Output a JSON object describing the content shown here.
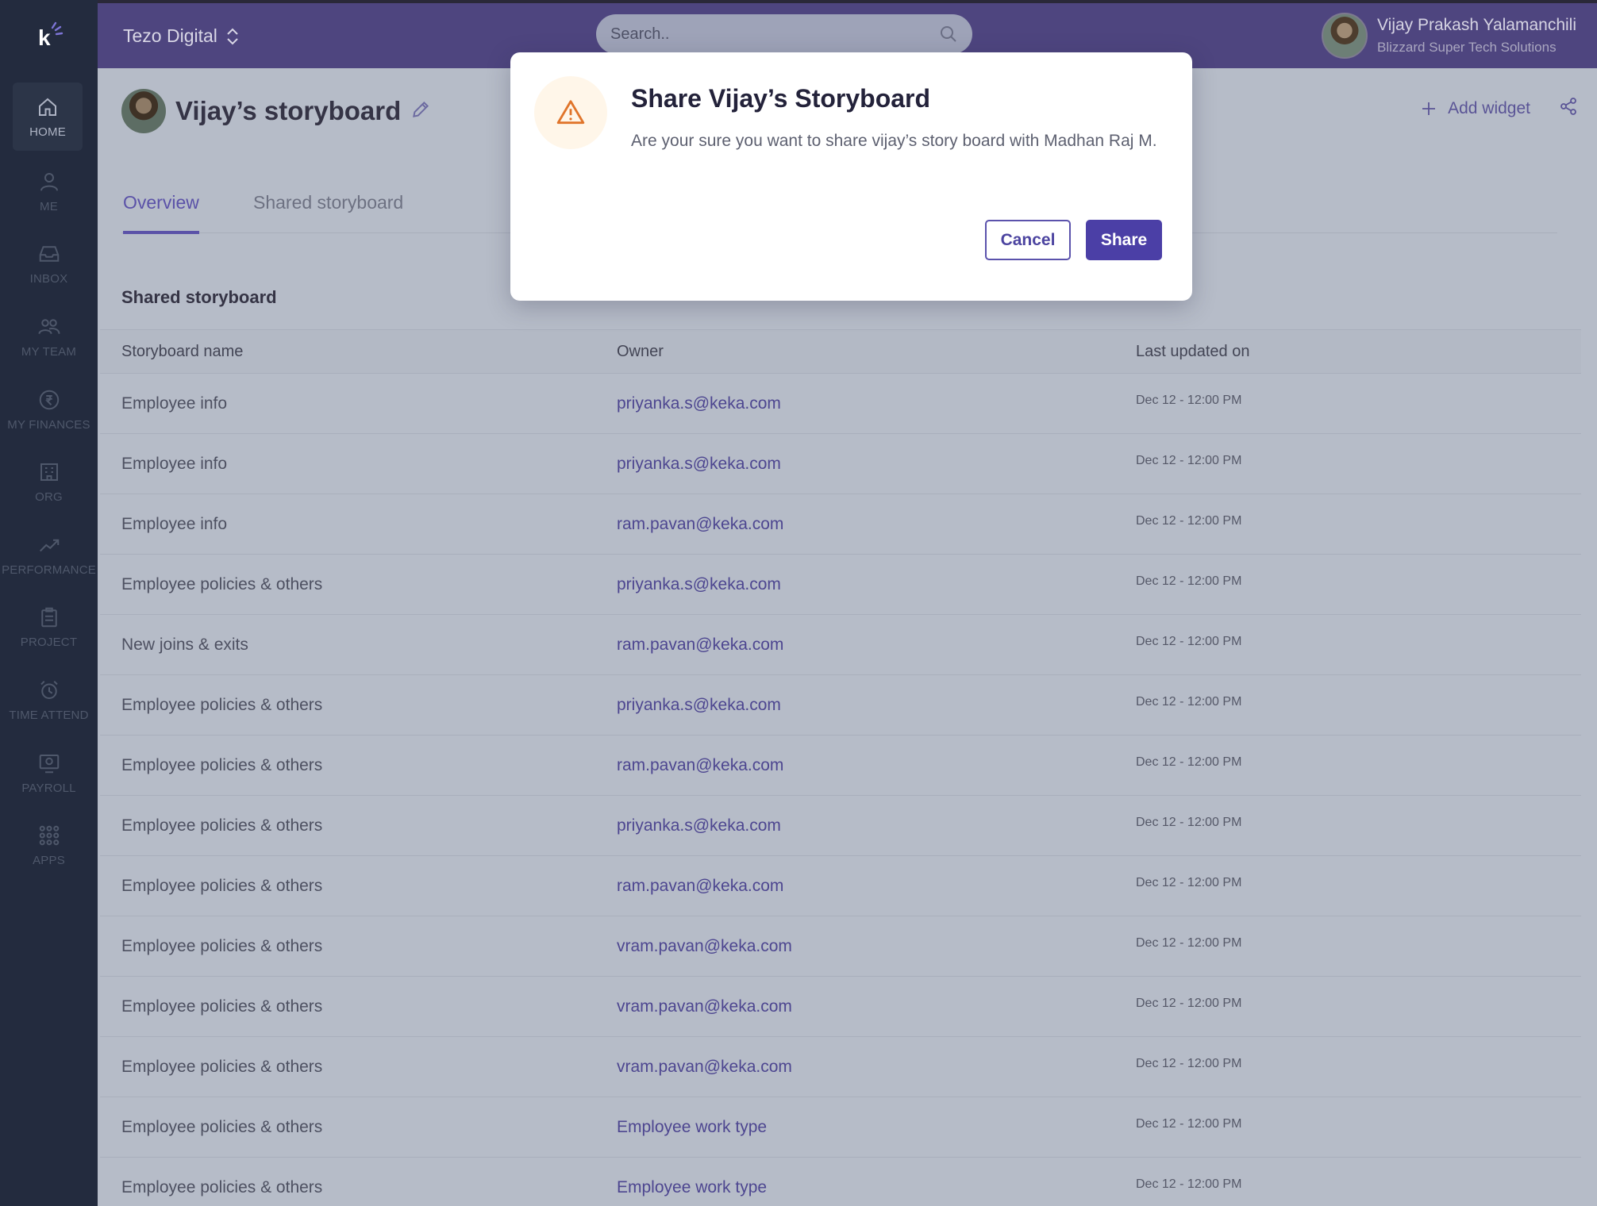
{
  "app": {
    "org_name": "Tezo Digital",
    "logo_letter": "k"
  },
  "search": {
    "placeholder": "Search.."
  },
  "user": {
    "name": "Vijay Prakash Yalamanchili",
    "company": "Blizzard Super Tech Solutions"
  },
  "sidebar": {
    "items": [
      {
        "label": "HOME",
        "icon": "home-icon",
        "active": true
      },
      {
        "label": "ME",
        "icon": "person-icon"
      },
      {
        "label": "INBOX",
        "icon": "inbox-icon"
      },
      {
        "label": "MY TEAM",
        "icon": "team-icon"
      },
      {
        "label": "MY FINANCES",
        "icon": "rupee-icon"
      },
      {
        "label": "ORG",
        "icon": "building-icon"
      },
      {
        "label": "PERFORMANCE",
        "icon": "trend-icon"
      },
      {
        "label": "PROJECT",
        "icon": "clipboard-icon"
      },
      {
        "label": "TIME ATTEND",
        "icon": "alarm-icon"
      },
      {
        "label": "PAYROLL",
        "icon": "payroll-icon"
      },
      {
        "label": "APPS",
        "icon": "grid-icon"
      }
    ]
  },
  "board": {
    "title": "Vijay’s storyboard",
    "add_widget_label": "Add widget"
  },
  "tabs": [
    {
      "label": "Overview",
      "active": true
    },
    {
      "label": "Shared storyboard"
    }
  ],
  "section_title": "Shared storyboard",
  "table": {
    "headers": [
      "Storyboard name",
      "Owner",
      "Last updated on"
    ],
    "rows": [
      {
        "name": "Employee info",
        "owner": "priyanka.s@keka.com",
        "updated": "Dec 12 - 12:00 PM"
      },
      {
        "name": "Employee info",
        "owner": "priyanka.s@keka.com",
        "updated": "Dec 12 - 12:00 PM"
      },
      {
        "name": "Employee info",
        "owner": "ram.pavan@keka.com",
        "updated": "Dec 12 - 12:00 PM"
      },
      {
        "name": "Employee policies & others",
        "owner": "priyanka.s@keka.com",
        "updated": "Dec 12 - 12:00 PM"
      },
      {
        "name": "New joins & exits",
        "owner": "ram.pavan@keka.com",
        "updated": "Dec 12 - 12:00 PM"
      },
      {
        "name": "Employee policies & others",
        "owner": "priyanka.s@keka.com",
        "updated": "Dec 12 - 12:00 PM"
      },
      {
        "name": "Employee policies & others",
        "owner": "ram.pavan@keka.com",
        "updated": "Dec 12 - 12:00 PM"
      },
      {
        "name": "Employee policies & others",
        "owner": "priyanka.s@keka.com",
        "updated": "Dec 12 - 12:00 PM"
      },
      {
        "name": "Employee policies & others",
        "owner": "ram.pavan@keka.com",
        "updated": "Dec 12 - 12:00 PM"
      },
      {
        "name": "Employee policies & others",
        "owner": "vram.pavan@keka.com",
        "updated": "Dec 12 - 12:00 PM"
      },
      {
        "name": "Employee policies & others",
        "owner": "vram.pavan@keka.com",
        "updated": "Dec 12 - 12:00 PM"
      },
      {
        "name": "Employee policies & others",
        "owner": "vram.pavan@keka.com",
        "updated": "Dec 12 - 12:00 PM"
      },
      {
        "name": "Employee policies & others",
        "owner": "Employee work type",
        "updated": "Dec 12 - 12:00 PM"
      },
      {
        "name": "Employee policies & others",
        "owner": "Employee work type",
        "updated": "Dec 12 - 12:00 PM"
      }
    ]
  },
  "modal": {
    "title": "Share Vijay’s Storyboard",
    "message": "Are your sure you want to share vijay’s story board with Madhan Raj M.",
    "cancel_label": "Cancel",
    "share_label": "Share",
    "icon": "warning-icon"
  },
  "colors": {
    "primary": "#4b3fa6",
    "topbar": "#4e457f",
    "sidebar": "#232b3e",
    "warning": "#e0742a"
  }
}
